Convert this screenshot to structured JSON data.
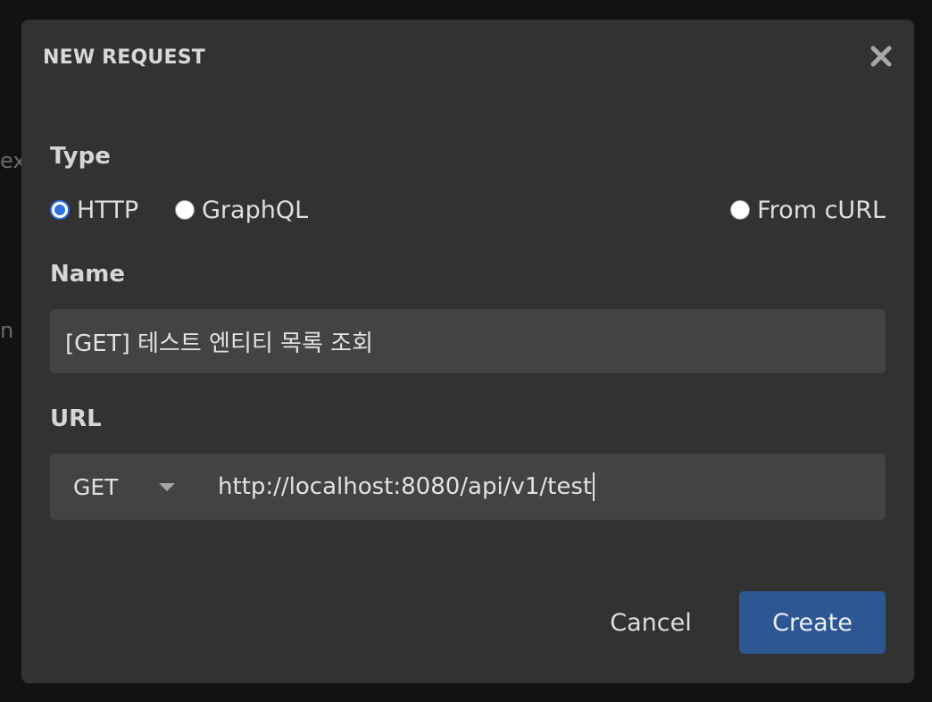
{
  "background": {
    "fragment_1": "ex",
    "fragment_2": "n"
  },
  "modal": {
    "title": "NEW REQUEST",
    "close_icon": "close-icon"
  },
  "type_section": {
    "label": "Type",
    "options": [
      {
        "label": "HTTP",
        "checked": true
      },
      {
        "label": "GraphQL",
        "checked": false
      },
      {
        "label": "From cURL",
        "checked": false
      }
    ]
  },
  "name_section": {
    "label": "Name",
    "value": "[GET] 테스트 엔티티 목록 조회"
  },
  "url_section": {
    "label": "URL",
    "method": "GET",
    "value": "http://localhost:8080/api/v1/test"
  },
  "footer": {
    "cancel_label": "Cancel",
    "create_label": "Create"
  },
  "colors": {
    "modal_bg": "#323232",
    "input_bg": "#434343",
    "accent": "#2f6fe6",
    "primary_button": "#2d5793"
  }
}
